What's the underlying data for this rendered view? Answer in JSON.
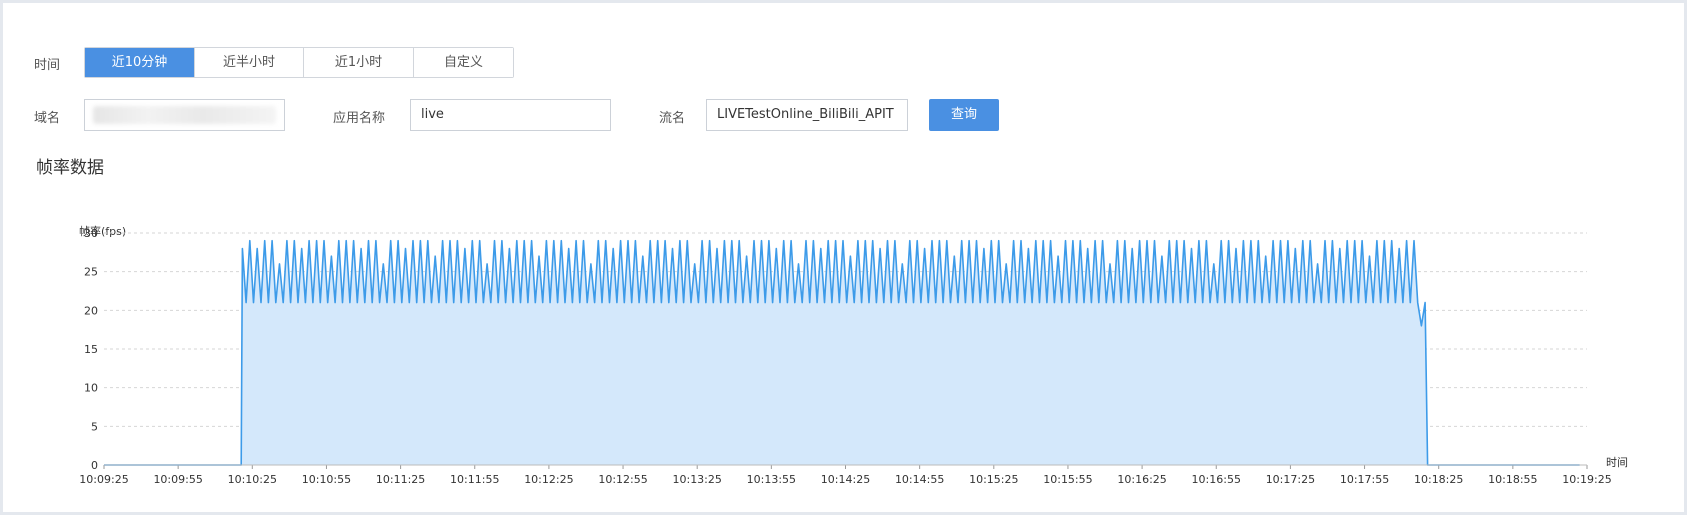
{
  "filters": {
    "time_label": "时间",
    "time_options": [
      "近10分钟",
      "近半小时",
      "近1小时",
      "自定义"
    ],
    "active_option": 0,
    "domain_label": "域名",
    "domain_value": "",
    "app_label": "应用名称",
    "app_value": "live",
    "stream_label": "流名",
    "stream_value": "LIVETestOnline_BiliBili_APIT",
    "query_label": "查询"
  },
  "section": {
    "title": "帧率数据"
  },
  "colors": {
    "accent": "#4a90e2",
    "line": "#3d9be9",
    "fill": "#d4e8fb"
  },
  "chart_data": {
    "type": "area",
    "ylabel": "帧率(fps)",
    "xlabel": "时间",
    "ylim": [
      0,
      30
    ],
    "yticks": [
      0,
      5,
      10,
      15,
      20,
      25,
      30
    ],
    "xticks": [
      "10:09:25",
      "10:09:55",
      "10:10:25",
      "10:10:55",
      "10:11:25",
      "10:11:55",
      "10:12:25",
      "10:12:55",
      "10:13:25",
      "10:13:55",
      "10:14:25",
      "10:14:55",
      "10:15:25",
      "10:15:55",
      "10:16:25",
      "10:16:55",
      "10:17:25",
      "10:17:55",
      "10:18:25",
      "10:18:55",
      "10:19:25"
    ],
    "grid": true,
    "series": [
      {
        "start": "10:09:25",
        "end": "10:19:25",
        "active_start": "10:10:21",
        "active_end": "10:18:20",
        "oscillation": {
          "min": 21,
          "max": 29,
          "period_seconds": 3
        },
        "values_sample": [
          0,
          0,
          28,
          22,
          29,
          21,
          29,
          22,
          29,
          21,
          28,
          22,
          29,
          21,
          26,
          22,
          29,
          21,
          29,
          18,
          29,
          0,
          0
        ]
      }
    ]
  }
}
